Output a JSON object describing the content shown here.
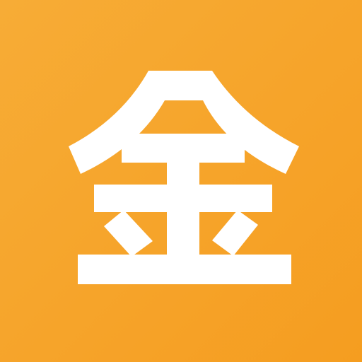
{
  "icon": {
    "name": "gold-character-logo",
    "glyph": "金",
    "colors": {
      "background_light": "#F7AC36",
      "background_dark": "#F59D20",
      "glyph": "#FFFFFF"
    }
  }
}
